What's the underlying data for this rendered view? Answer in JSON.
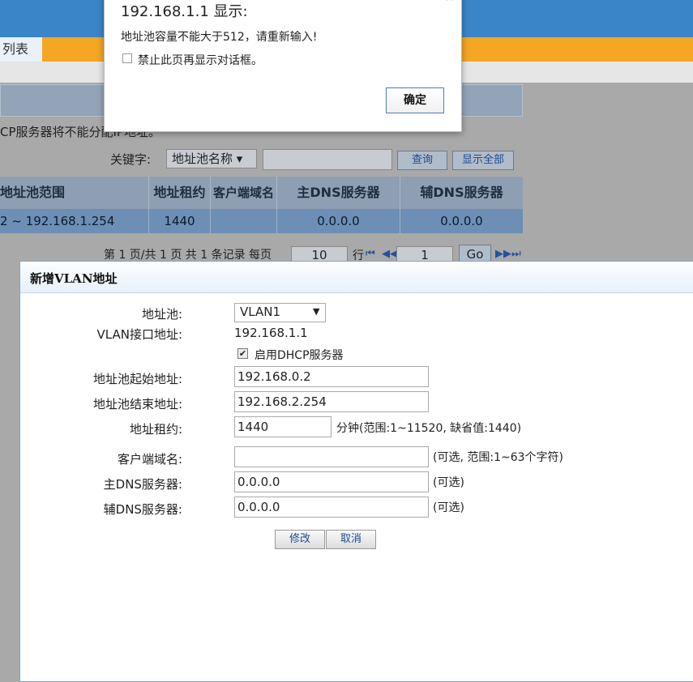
{
  "background": {
    "tab_label": "列表",
    "info_text": "CP服务器将不能分配IP地址。",
    "keyword_label": "关键字:",
    "keyword_select": "地址池名称 ▾",
    "search_button": "查询",
    "show_all_button": "显示全部",
    "table": {
      "headers": [
        "地址池范围",
        "地址租约",
        "客户端域名",
        "主DNS服务器",
        "辅DNS服务器"
      ],
      "rows": [
        [
          "2 ~ 192.168.1.254",
          "1440",
          "",
          "0.0.0.0",
          "0.0.0.0"
        ]
      ]
    },
    "pager": {
      "text": "第 1 页/共 1 页 共 1 条记录 每页",
      "per_page": "10",
      "rows_label": "行",
      "page": "1",
      "go": "Go"
    }
  },
  "alert": {
    "title": "192.168.1.1 显示:",
    "message": "地址池容量不能大于512，请重新输入!",
    "checkbox_label": "禁止此页再显示对话框。",
    "ok": "确定",
    "close": "×"
  },
  "vlan_dialog": {
    "title": "新增VLAN地址",
    "pool_label": "地址池:",
    "pool_value": "VLAN1",
    "if_label": "VLAN接口地址:",
    "if_value": "192.168.1.1",
    "dhcp_label": "启用DHCP服务器",
    "start_label": "地址池起始地址:",
    "start_value": "192.168.0.2",
    "end_label": "地址池结束地址:",
    "end_value": "192.168.2.254",
    "lease_label": "地址租约:",
    "lease_value": "1440",
    "lease_hint": "分钟(范围:1~11520, 缺省值:1440)",
    "domain_label": "客户端域名:",
    "domain_value": "",
    "domain_hint": "(可选, 范围:1~63个字符)",
    "dns1_label": "主DNS服务器:",
    "dns1_value": "0.0.0.0",
    "dns1_hint": "(可选)",
    "dns2_label": "辅DNS服务器:",
    "dns2_value": "0.0.0.0",
    "dns2_hint": "(可选)",
    "modify_button": "修改",
    "cancel_button": "取消"
  }
}
